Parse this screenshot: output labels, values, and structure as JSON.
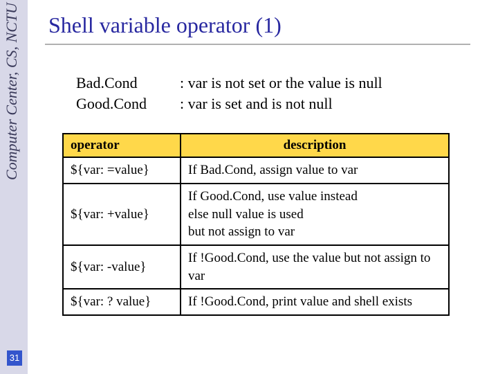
{
  "sidebar": {
    "institution": "Computer Center, CS, NCTU"
  },
  "slide": {
    "number": "31",
    "title": "Shell variable operator (1)"
  },
  "definitions": {
    "items": [
      {
        "term": "Bad.Cond",
        "val": ": var is not set or the value is null"
      },
      {
        "term": "Good.Cond",
        "val": ": var is set and is not null"
      }
    ]
  },
  "table": {
    "headers": {
      "op": "operator",
      "desc": "description"
    },
    "rows": [
      {
        "op": "${var: =value}",
        "desc": "If Bad.Cond, assign value to var"
      },
      {
        "op": "${var: +value}",
        "desc": "If Good.Cond, use value instead\nelse null value is used\nbut not assign to var"
      },
      {
        "op": "${var: -value}",
        "desc": "If !Good.Cond, use the value but not assign to var"
      },
      {
        "op": "${var: ? value}",
        "desc": "If !Good.Cond, print value and shell exists"
      }
    ]
  }
}
